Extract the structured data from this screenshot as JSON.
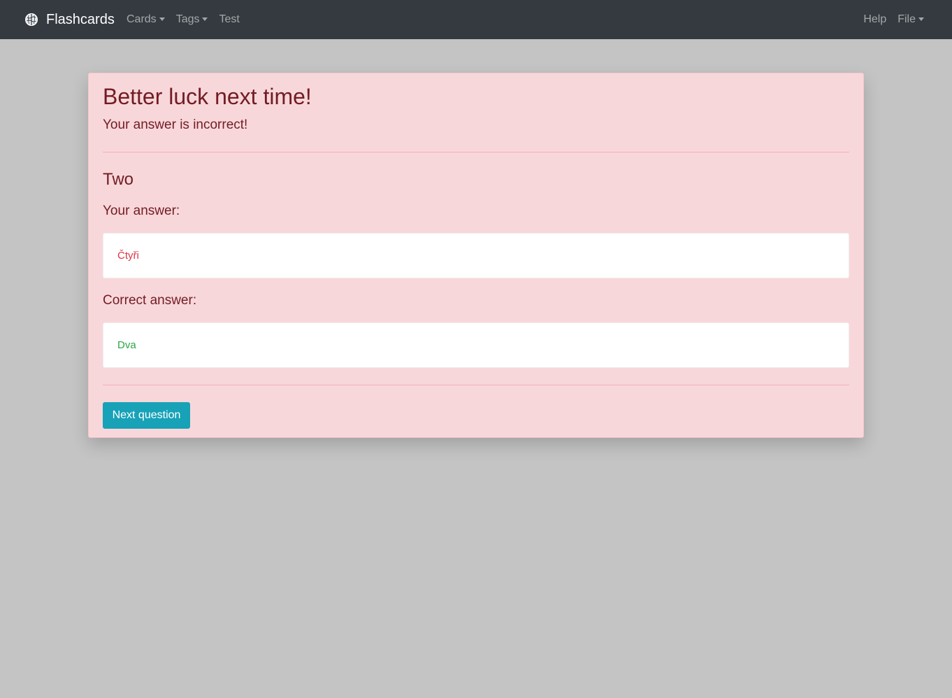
{
  "navbar": {
    "brand": "Flashcards",
    "brand_icon": "brain-icon",
    "left_items": [
      {
        "label": "Cards",
        "dropdown": true
      },
      {
        "label": "Tags",
        "dropdown": true
      },
      {
        "label": "Test",
        "dropdown": false
      }
    ],
    "right_items": [
      {
        "label": "Help",
        "dropdown": false
      },
      {
        "label": "File",
        "dropdown": true
      }
    ]
  },
  "result": {
    "heading": "Better luck next time!",
    "subtitle": "Your answer is incorrect!",
    "question": "Two",
    "your_answer_label": "Your answer:",
    "your_answer_value": "Čtyři",
    "correct_answer_label": "Correct answer:",
    "correct_answer_value": "Dva",
    "next_button": "Next question"
  },
  "colors": {
    "navbar_bg": "#343a40",
    "page_bg": "#c4c4c4",
    "alert_bg": "#f8d7da",
    "alert_text": "#721c24",
    "wrong_answer": "#dc3545",
    "correct_answer": "#28a745",
    "button_bg": "#17a2b8"
  }
}
